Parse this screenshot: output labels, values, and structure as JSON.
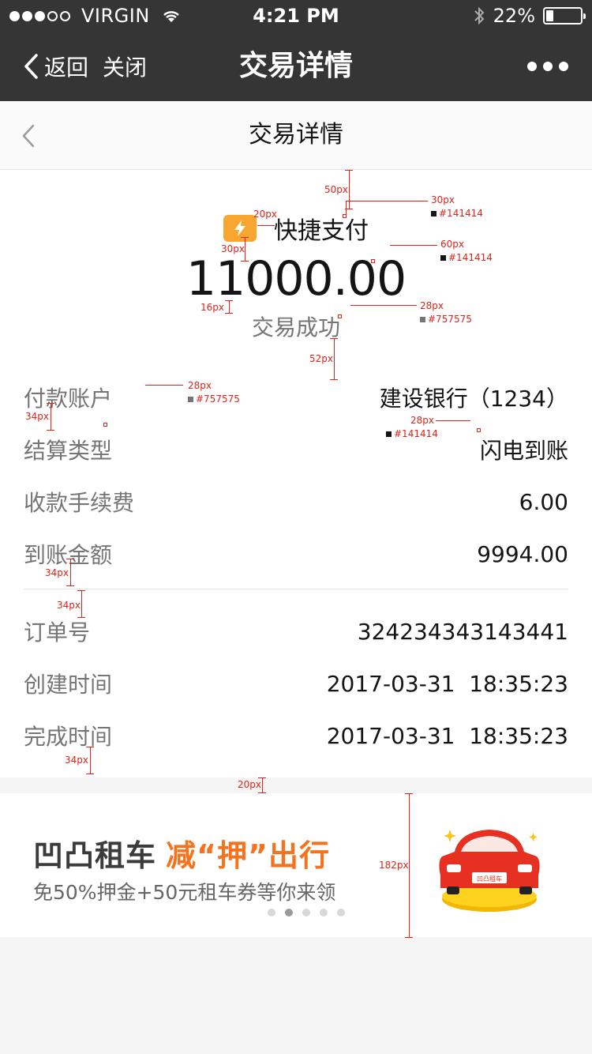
{
  "status_bar": {
    "carrier": "VIRGIN",
    "time": "4:21 PM",
    "battery": "22%",
    "battery_level": 0.22,
    "signal_bars": 3,
    "signal_total": 5
  },
  "nav": {
    "back_label": "返回",
    "close_label": "关闭",
    "title": "交易详情"
  },
  "page_header": {
    "title": "交易详情"
  },
  "payment": {
    "method": "快捷支付",
    "amount": "11000.00",
    "status": "交易成功"
  },
  "details": [
    {
      "label": "付款账户",
      "value": "建设银行（1234）"
    },
    {
      "label": "结算类型",
      "value": "闪电到账"
    },
    {
      "label": "收款手续费",
      "value": "6.00"
    },
    {
      "label": "到账金额",
      "value": "9994.00"
    }
  ],
  "order": [
    {
      "label": "订单号",
      "value": "324234343143441"
    },
    {
      "label": "创建时间",
      "value": "2017-03-31  18:35:23"
    },
    {
      "label": "完成时间",
      "value": "2017-03-31  18:35:23"
    }
  ],
  "annotations": {
    "a1": "50px",
    "a2": "20px",
    "a3": "30px",
    "a3c": "#141414",
    "a4": "30px",
    "a5": "60px",
    "a5c": "#141414",
    "a6": "16px",
    "a7": "28px",
    "a7c": "#757575",
    "a8": "52px",
    "a9": "28px",
    "a9c": "#757575",
    "a10": "34px",
    "a11": "28px",
    "a11c": "#141414",
    "a12": "34px",
    "a13": "34px",
    "a14": "34px",
    "a15": "20px",
    "a16": "182px"
  },
  "banner": {
    "brand": "凹凸租车",
    "highlight": "减“押”出行",
    "subtitle": "免50%押金+50元租车券等你来领",
    "car_plate": "凹凸租车",
    "pages": 5,
    "active_page": 2
  },
  "colors": {
    "bar_bg": "#353535",
    "text_primary": "#141414",
    "text_secondary": "#757575",
    "accent_orange": "#f5731f",
    "icon_yellow": "#f7a730",
    "annotation_red": "#e2231a"
  }
}
